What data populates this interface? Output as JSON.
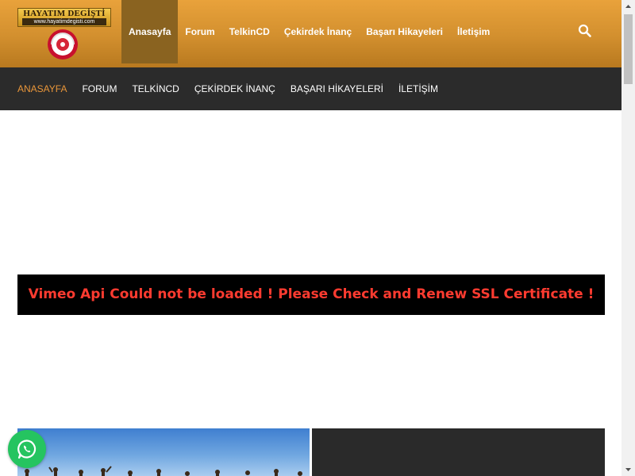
{
  "logo": {
    "title": "HAYATIM DEGİŞTİ",
    "url": "www.hayatimdegisti.com"
  },
  "main_nav": [
    {
      "label": "Anasayfa",
      "active": true
    },
    {
      "label": "Forum",
      "active": false
    },
    {
      "label": "TelkinCD",
      "active": false
    },
    {
      "label": "Çekirdek İnanç",
      "active": false
    },
    {
      "label": "Başarı Hikayeleri",
      "active": false
    },
    {
      "label": "İletişim",
      "active": false
    }
  ],
  "sub_nav": [
    {
      "label": "ANASAYFA",
      "active": true
    },
    {
      "label": "FORUM",
      "active": false
    },
    {
      "label": "TELKİNCD",
      "active": false
    },
    {
      "label": "ÇEKİRDEK İNANÇ",
      "active": false
    },
    {
      "label": "BAŞARI HİKAYELERİ",
      "active": false
    },
    {
      "label": "İLETİŞİM",
      "active": false
    }
  ],
  "video": {
    "error_message": "Vimeo Api Could not be loaded ! Please Check and Renew SSL Certificate !"
  },
  "icons": {
    "search": "search-icon",
    "whatsapp": "whatsapp-icon",
    "scroll_up": "scroll-up-arrow-icon",
    "scroll_down": "scroll-down-arrow-icon"
  },
  "colors": {
    "header_orange": "#d9962f",
    "active_tab": "#8a6320",
    "subnav_bg": "#2b2b2b",
    "subnav_active": "#e9963a",
    "error_red": "#ff3b30",
    "whatsapp_green": "#25c460"
  }
}
